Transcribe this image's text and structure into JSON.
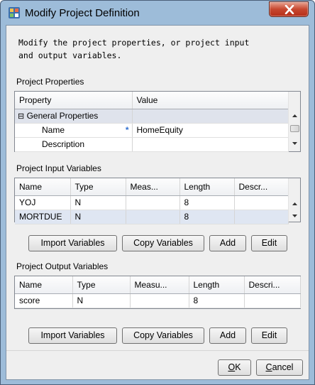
{
  "window": {
    "title": "Modify Project Definition"
  },
  "intro_text": "Modify the project properties, or project input\nand output variables.",
  "properties": {
    "label": "Project Properties",
    "columns": [
      "Property",
      "Value"
    ],
    "group_row": {
      "expander": "⊟",
      "label": "General Properties"
    },
    "rows": [
      {
        "property": "Name",
        "required_marker": "*",
        "value": "HomeEquity"
      },
      {
        "property": "Description",
        "value": ""
      }
    ]
  },
  "input_vars": {
    "label": "Project Input Variables",
    "columns": [
      "Name",
      "Type",
      "Meas...",
      "Length",
      "Descr..."
    ],
    "rows": [
      {
        "name": "YOJ",
        "type": "N",
        "measure": "",
        "length": "8",
        "description": ""
      },
      {
        "name": "MORTDUE",
        "type": "N",
        "measure": "",
        "length": "8",
        "description": ""
      }
    ],
    "buttons": {
      "import": "Import Variables",
      "copy": "Copy Variables",
      "add": "Add",
      "edit": "Edit"
    }
  },
  "output_vars": {
    "label": "Project Output Variables",
    "columns": [
      "Name",
      "Type",
      "Measu...",
      "Length",
      "Descri..."
    ],
    "rows": [
      {
        "name": "score",
        "type": "N",
        "measure": "",
        "length": "8",
        "description": ""
      }
    ],
    "buttons": {
      "import": "Import Variables",
      "copy": "Copy Variables",
      "add": "Add",
      "edit": "Edit"
    }
  },
  "footer": {
    "ok": {
      "mnemonic": "O",
      "rest": "K"
    },
    "cancel": {
      "mnemonic": "C",
      "rest": "ancel"
    }
  },
  "colors": {
    "title_bar": "#9dbcd9",
    "close_button": "#c7472f",
    "selected_row": "#dfe6f2"
  }
}
